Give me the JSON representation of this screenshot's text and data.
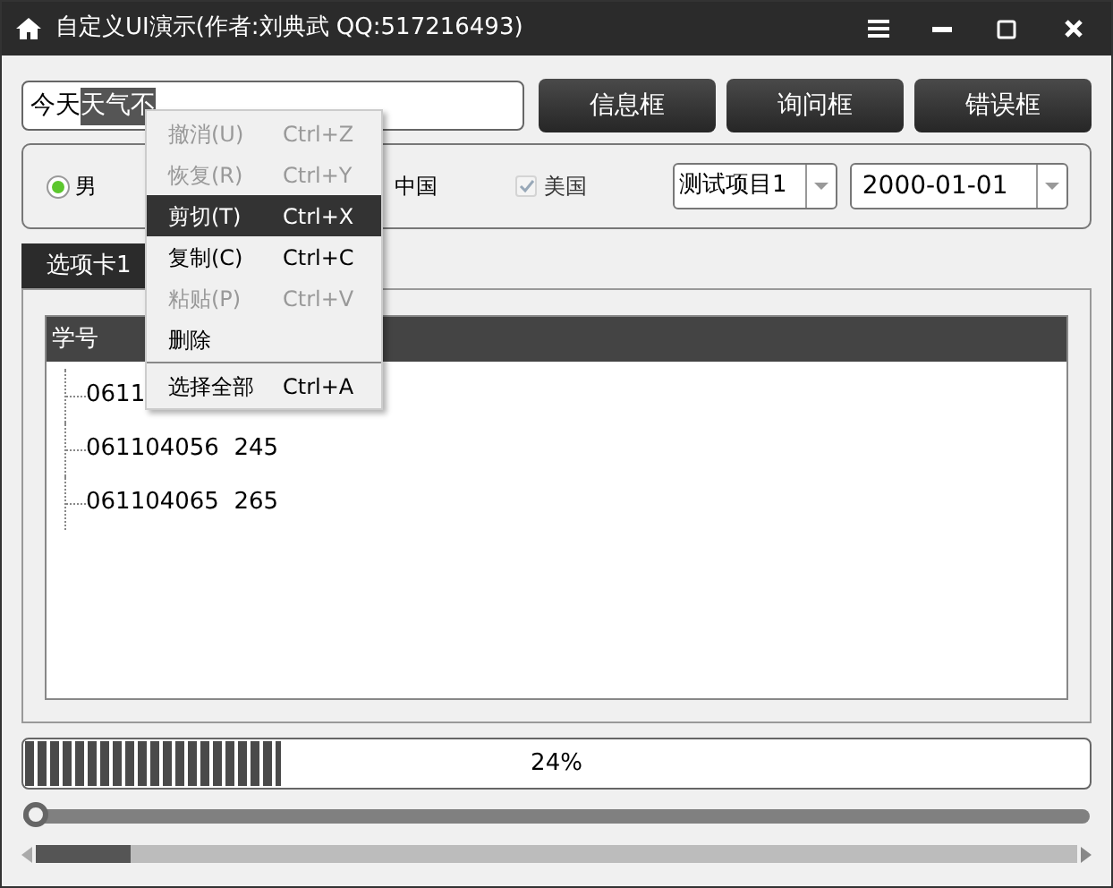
{
  "window": {
    "title": "自定义UI演示(作者:刘典武 QQ:517216493)"
  },
  "text_input": {
    "parts": [
      {
        "text": "今天",
        "selected": false
      },
      {
        "text": "天气不",
        "selected": true
      }
    ]
  },
  "buttons": [
    "信息框",
    "询问框",
    "错误框"
  ],
  "options": [
    {
      "kind": "radio",
      "label": "男",
      "checked": true,
      "disabled": false
    },
    {
      "kind": "label",
      "label": "中国"
    },
    {
      "kind": "checkbox",
      "label": "美国",
      "checked": true,
      "disabled": true
    }
  ],
  "combo": {
    "value": "测试项目1"
  },
  "date": {
    "value": "2000-01-01"
  },
  "tabs": [
    {
      "label": "选项卡1",
      "selected": true
    }
  ],
  "tree": {
    "columns": [
      "学号"
    ],
    "rows": [
      {
        "text": "0611"
      },
      {
        "text": "061104056  245"
      },
      {
        "text": "061104065  265"
      }
    ]
  },
  "progress": {
    "level": 0.24,
    "reading": "24%"
  },
  "slider": {
    "level": 0
  },
  "context_menu": [
    {
      "kind": "item",
      "label": "撤消(U)",
      "shortcut": "Ctrl+Z",
      "disabled": true,
      "selected": false
    },
    {
      "kind": "item",
      "label": "恢复(R)",
      "shortcut": "Ctrl+Y",
      "disabled": true,
      "selected": false
    },
    {
      "kind": "item",
      "label": "剪切(T)",
      "shortcut": "Ctrl+X",
      "disabled": false,
      "selected": true
    },
    {
      "kind": "item",
      "label": "复制(C)",
      "shortcut": "Ctrl+C",
      "disabled": false,
      "selected": false
    },
    {
      "kind": "item",
      "label": "粘贴(P)",
      "shortcut": "Ctrl+V",
      "disabled": true,
      "selected": false
    },
    {
      "kind": "item",
      "label": "删除",
      "disabled": false,
      "selected": false
    },
    {
      "kind": "separator"
    },
    {
      "kind": "item",
      "label": "选择全部",
      "shortcut": "Ctrl+A",
      "disabled": false,
      "selected": false
    }
  ]
}
